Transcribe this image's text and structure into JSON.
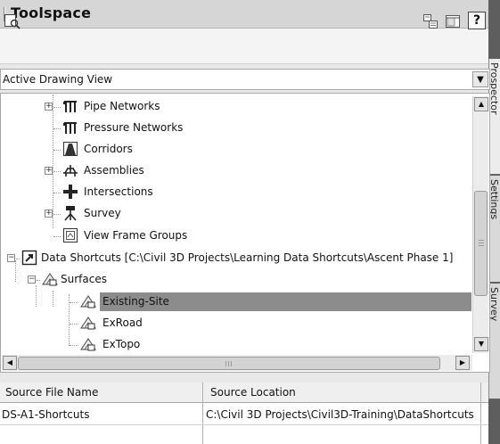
{
  "window": {
    "title": "Toolspace"
  },
  "side_tabs": [
    "Prospector",
    "Settings",
    "Survey"
  ],
  "toolbar": {
    "help_label": "?",
    "icons": [
      "preview-icon",
      "item-view-icon",
      "panorama-icon",
      "help-icon"
    ]
  },
  "view_selector": {
    "selected": "Active Drawing View"
  },
  "tree": {
    "items": [
      {
        "label": "Pipe Networks",
        "icon": "pipe-networks-icon",
        "expander": "+"
      },
      {
        "label": "Pressure Networks",
        "icon": "pressure-networks-icon"
      },
      {
        "label": "Corridors",
        "icon": "corridors-icon"
      },
      {
        "label": "Assemblies",
        "icon": "assemblies-icon",
        "expander": "+"
      },
      {
        "label": "Intersections",
        "icon": "intersections-icon"
      },
      {
        "label": "Survey",
        "icon": "survey-icon",
        "expander": "+"
      },
      {
        "label": "View Frame Groups",
        "icon": "view-frame-groups-icon"
      },
      {
        "label": "Data Shortcuts [C:\\Civil 3D Projects\\Learning Data Shortcuts\\Ascent Phase 1]",
        "icon": "data-shortcuts-icon",
        "expander": "−"
      },
      {
        "label": "Surfaces",
        "icon": "surfaces-icon",
        "expander": "−"
      },
      {
        "label": "Existing-Site",
        "icon": "surface-shortcut-icon",
        "selected": true
      },
      {
        "label": "ExRoad",
        "icon": "surface-shortcut-icon"
      },
      {
        "label": "ExTopo",
        "icon": "surface-shortcut-icon"
      }
    ]
  },
  "table": {
    "columns": [
      "Source File Name",
      "Source Location"
    ],
    "rows": [
      [
        "DS-A1-Shortcuts",
        "C:\\Civil 3D Projects\\Civil3D-Training\\DataShortcuts"
      ]
    ]
  },
  "colors": {
    "selection": "#8c8c8c",
    "title_bar": "#d6d6d6",
    "panel": "#ffffff"
  }
}
